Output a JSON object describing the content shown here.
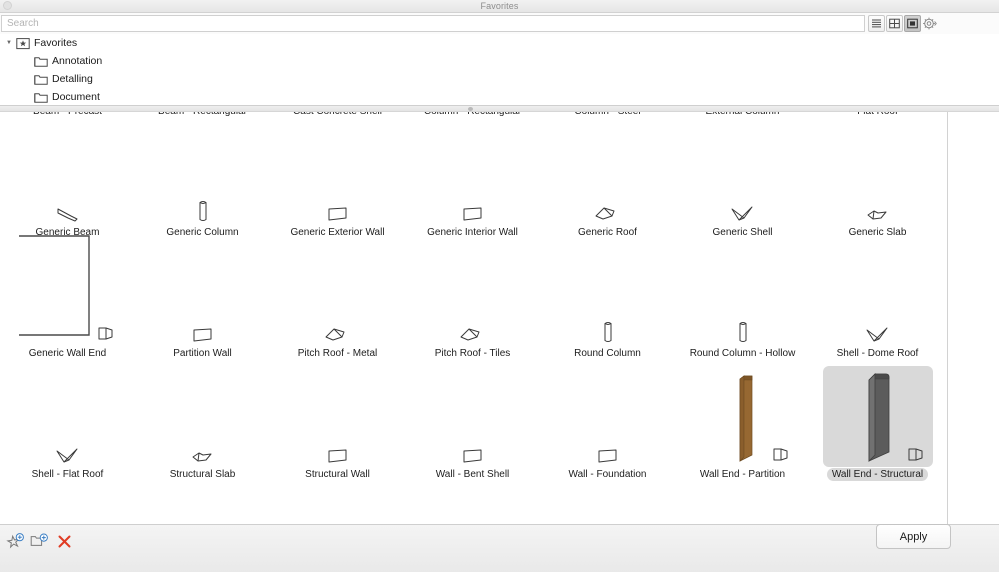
{
  "window": {
    "title": "Favorites",
    "close_icon": "close-circle-icon"
  },
  "search": {
    "placeholder": "Search",
    "value": ""
  },
  "view_buttons": [
    {
      "id": "view-list",
      "icon": "list-view-icon",
      "label": "List View",
      "selected": false
    },
    {
      "id": "view-grid",
      "icon": "grid-view-icon",
      "label": "Grid View",
      "selected": false
    },
    {
      "id": "view-icon",
      "icon": "large-icon-view-icon",
      "label": "Large Icon View",
      "selected": true
    },
    {
      "id": "view-settings",
      "icon": "gear-icon",
      "label": "View Settings",
      "selected": false
    }
  ],
  "tree": {
    "items": [
      {
        "label": "Favorites",
        "icon": "star-folder-icon",
        "depth": 0,
        "expanded": true,
        "twisty": "▼"
      },
      {
        "label": "Annotation",
        "icon": "folder-icon",
        "depth": 1,
        "expanded": false,
        "twisty": ""
      },
      {
        "label": "Detalling",
        "icon": "folder-icon",
        "depth": 1,
        "expanded": false,
        "twisty": ""
      },
      {
        "label": "Document",
        "icon": "folder-icon",
        "depth": 1,
        "expanded": false,
        "twisty": ""
      }
    ]
  },
  "grid": {
    "columns": 7,
    "items": [
      {
        "label": "Beam - Precast",
        "icon": "beam-icon",
        "row": 0,
        "col": 0,
        "selected": false,
        "preview": "none"
      },
      {
        "label": "Beam - Rectangular",
        "icon": "beam-icon",
        "row": 0,
        "col": 1,
        "selected": false,
        "preview": "none"
      },
      {
        "label": "Cast Concrete Shell",
        "icon": "shell-icon",
        "row": 0,
        "col": 2,
        "selected": false,
        "preview": "none"
      },
      {
        "label": "Column - Rectangular",
        "icon": "column-icon",
        "row": 0,
        "col": 3,
        "selected": false,
        "preview": "none"
      },
      {
        "label": "Column - Steel",
        "icon": "column-icon",
        "row": 0,
        "col": 4,
        "selected": false,
        "preview": "none"
      },
      {
        "label": "External Column",
        "icon": "column-icon",
        "row": 0,
        "col": 5,
        "selected": false,
        "preview": "none"
      },
      {
        "label": "Flat Roof",
        "icon": "roof-icon",
        "row": 0,
        "col": 6,
        "selected": false,
        "preview": "none"
      },
      {
        "label": "Generic Beam",
        "icon": "beam-icon",
        "row": 1,
        "col": 0,
        "selected": false,
        "preview": "none"
      },
      {
        "label": "Generic Column",
        "icon": "column-icon",
        "row": 1,
        "col": 1,
        "selected": false,
        "preview": "none"
      },
      {
        "label": "Generic Exterior Wall",
        "icon": "wall-icon",
        "row": 1,
        "col": 2,
        "selected": false,
        "preview": "none"
      },
      {
        "label": "Generic Interior Wall",
        "icon": "wall-icon",
        "row": 1,
        "col": 3,
        "selected": false,
        "preview": "none"
      },
      {
        "label": "Generic Roof",
        "icon": "pitch-roof-icon",
        "row": 1,
        "col": 4,
        "selected": false,
        "preview": "none"
      },
      {
        "label": "Generic Shell",
        "icon": "shell-icon",
        "row": 1,
        "col": 5,
        "selected": false,
        "preview": "none"
      },
      {
        "label": "Generic Slab",
        "icon": "slab-icon",
        "row": 1,
        "col": 6,
        "selected": false,
        "preview": "none"
      },
      {
        "label": "Generic Wall End",
        "icon": "wall-end-icon",
        "row": 2,
        "col": 0,
        "selected": false,
        "preview": "wireframe-bracket"
      },
      {
        "label": "Partition Wall",
        "icon": "wall-icon",
        "row": 2,
        "col": 1,
        "selected": false,
        "preview": "none"
      },
      {
        "label": "Pitch Roof - Metal",
        "icon": "pitch-roof-icon",
        "row": 2,
        "col": 2,
        "selected": false,
        "preview": "none"
      },
      {
        "label": "Pitch Roof - Tiles",
        "icon": "pitch-roof-icon",
        "row": 2,
        "col": 3,
        "selected": false,
        "preview": "none"
      },
      {
        "label": "Round Column",
        "icon": "column-icon",
        "row": 2,
        "col": 4,
        "selected": false,
        "preview": "none"
      },
      {
        "label": "Round Column - Hollow",
        "icon": "column-icon",
        "row": 2,
        "col": 5,
        "selected": false,
        "preview": "none"
      },
      {
        "label": "Shell - Dome Roof",
        "icon": "shell-icon",
        "row": 2,
        "col": 6,
        "selected": false,
        "preview": "none"
      },
      {
        "label": "Shell - Flat Roof",
        "icon": "shell-icon",
        "row": 3,
        "col": 0,
        "selected": false,
        "preview": "none"
      },
      {
        "label": "Structural Slab",
        "icon": "slab-icon",
        "row": 3,
        "col": 1,
        "selected": false,
        "preview": "none"
      },
      {
        "label": "Structural Wall",
        "icon": "wall-icon",
        "row": 3,
        "col": 2,
        "selected": false,
        "preview": "none"
      },
      {
        "label": "Wall - Bent Shell",
        "icon": "wall-icon",
        "row": 3,
        "col": 3,
        "selected": false,
        "preview": "none"
      },
      {
        "label": "Wall - Foundation",
        "icon": "wall-icon",
        "row": 3,
        "col": 4,
        "selected": false,
        "preview": "none"
      },
      {
        "label": "Wall End - Partition",
        "icon": "wall-end-icon",
        "row": 3,
        "col": 5,
        "selected": false,
        "preview": "wood-wall"
      },
      {
        "label": "Wall End - Structural",
        "icon": "wall-end-icon",
        "row": 3,
        "col": 6,
        "selected": true,
        "preview": "gray-wall"
      }
    ]
  },
  "bottom_toolbar": {
    "buttons": [
      {
        "id": "btn-add-fav",
        "icon": "add-favorite-icon",
        "label": "Add Favorite"
      },
      {
        "id": "btn-new-folder",
        "icon": "new-folder-icon",
        "label": "New Folder"
      },
      {
        "id": "btn-delete",
        "icon": "delete-x-icon",
        "label": "Delete"
      }
    ],
    "apply_label": "Apply"
  },
  "colors": {
    "selection": "#d9d9d9",
    "wood_preview": "#9a6b33",
    "gray_preview": "#5c5c5c",
    "delete_red": "#e03b24",
    "accent_blue": "#3b7fc4"
  }
}
